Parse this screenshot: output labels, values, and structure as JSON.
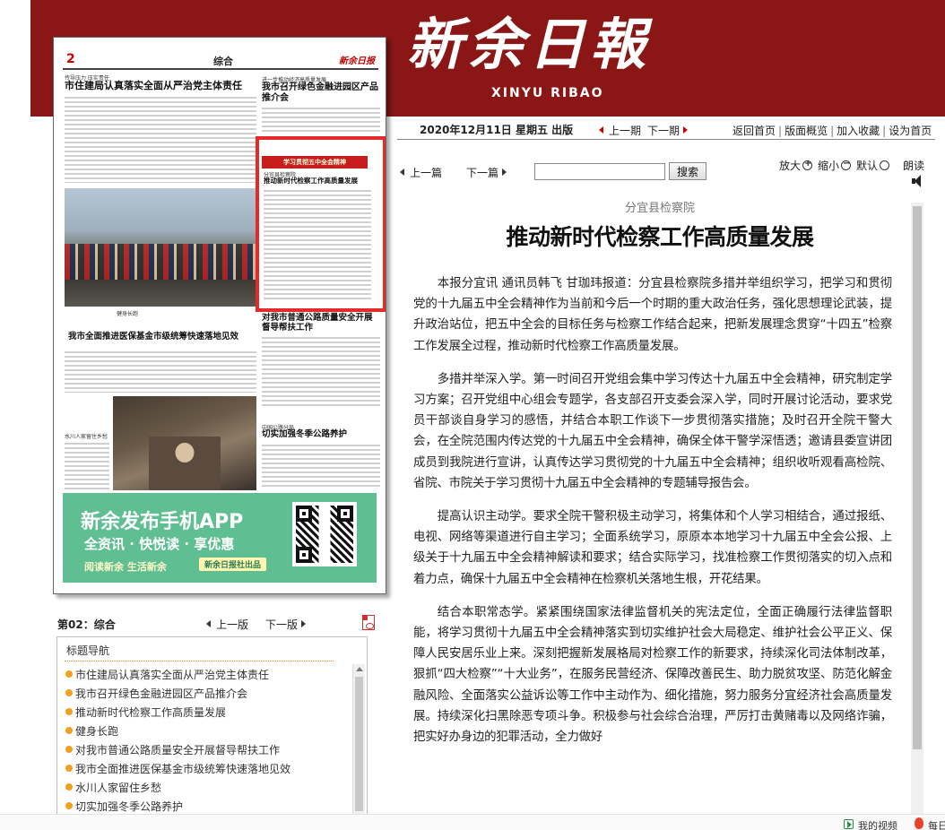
{
  "masthead": {
    "title_cn": "新余日報",
    "title_en": "XINYU RIBAO"
  },
  "page_thumb": {
    "page_number": "2",
    "section": "综合",
    "logo": "新余日报",
    "headline_main_kicker": "传导压力 压实责任",
    "headline_main": "市住建局认真落实全面从严治党主体责任",
    "headline_right_kicker": "进一步推动经济高质量发展",
    "headline_right": "我市召开绿色金融进园区产品推介会",
    "highlight_bar": "学习贯彻五中全会精神",
    "highlight_kicker": "分宜县检察院",
    "highlight_title": "推动新时代检察工作高质量发展",
    "photo_caption": "健身长跑",
    "headline_mid": "我市全面推进医保基金市级统筹快速落地见效",
    "headline_road": "对我市普通公路质量安全开展督导帮扶工作",
    "caption_2": "水川人家留住乡愁",
    "headline_winter_kicker": "中国公路分局",
    "headline_winter": "切实加强冬季公路养护",
    "ad_title": "新余发布手机APP",
    "ad_sub": "全资讯 · 快悦读 · 享优惠",
    "ad_slogan": "阅读新余 生活新余",
    "ad_tag": "新余日报社出品"
  },
  "page_nav": {
    "current": "第02：综合",
    "prev": "上一版",
    "next": "下一版"
  },
  "toc": {
    "title": "标题导航",
    "items": [
      "市住建局认真落实全面从严治党主体责任",
      "我市召开绿色金融进园区产品推介会",
      "推动新时代检察工作高质量发展",
      "健身长跑",
      "对我市普通公路质量安全开展督导帮扶工作",
      "我市全面推进医保基金市级统筹快速落地见效",
      "水川人家留住乡愁",
      "切实加强冬季公路养护"
    ]
  },
  "info_bar": {
    "date": "2020年12月11日 星期五 出版",
    "prev_issue": "上一期",
    "next_issue": "下一期",
    "links": [
      "返回首页",
      "版面概览",
      "加入收藏",
      "设为首页"
    ]
  },
  "toolbar": {
    "prev_article": "上一篇",
    "next_article": "下一篇",
    "search_value": "",
    "search_button": "搜索",
    "zoom_in": "放大",
    "zoom_out": "缩小",
    "default": "默认",
    "read_aloud": "朗读"
  },
  "article": {
    "source": "分宜县检察院",
    "title": "推动新时代检察工作高质量发展",
    "paragraphs": [
      "本报分宜讯 通讯员韩飞 甘珈玮报道：分宜县检察院多措并举组织学习，把学习和贯彻党的十九届五中全会精神作为当前和今后一个时期的重大政治任务，强化思想理论武装，提升政治站位，把五中全会的目标任务与检察工作结合起来，把新发展理念贯穿“十四五”检察工作发展全过程，推动新时代检察工作高质量发展。",
      "多措并举深入学。第一时间召开党组会集中学习传达十九届五中全会精神，研究制定学习方案；召开党组中心组会专题学，各支部召开支委会深入学，同时开展讨论活动，要求党员干部谈自身学习的感悟，并结合本职工作谈下一步贯彻落实措施；及时召开全院干警大会，在全院范围内传达党的十九届五中全会精神，确保全体干警学深悟透；邀请县委宣讲团成员到我院进行宣讲，认真传达学习贯彻党的十九届五中全会精神；组织收听观看高检院、省院、市院关于学习贯彻十九届五中全会精神的专题辅导报告会。",
      "提高认识主动学。要求全院干警积极主动学习，将集体和个人学习相结合，通过报纸、电视、网络等渠道进行自主学习；全面系统学习，原原本本地学习十九届五中全会公报、上级关于十九届五中全会精神解读和要求；结合实际学习，找准检察工作贯彻落实的切入点和着力点，确保十九届五中全会精神在检察机关落地生根，开花结果。",
      "结合本职常态学。紧紧围绕国家法律监督机关的宪法定位，全面正确履行法律监督职能，将学习贯彻十九届五中全会精神落实到切实维护社会大局稳定、维护社会公平正义、保障人民安居乐业上来。深刻把握新发展格局对检察工作的新要求，持续深化司法体制改革，狠抓“四大检察”“十大业务”，在服务民营经济、保障改善民生、助力脱贫攻坚、防范化解金融风险、全面落实公益诉讼等工作中主动作为、细化措施，努力服务分宜经济社会高质量发展。持续深化扫黑除恶专项斗争。积极参与社会综合治理，严厉打击黄赌毒以及网络诈骗，把实好办身边的犯罪活动，全力做好"
    ]
  },
  "bottom_bar": {
    "video": "我的视频",
    "hot": "每日"
  },
  "colors": {
    "banner": "#8a1616",
    "highlight": "#e62a2a",
    "ad_green": "#5fbf92",
    "bullet": "#f1a021"
  }
}
